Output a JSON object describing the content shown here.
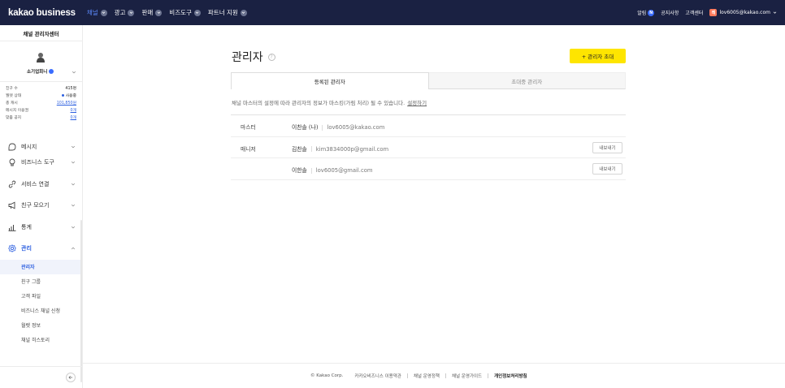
{
  "header": {
    "brand": "kakao business",
    "nav": [
      {
        "label": "채널",
        "active": true
      },
      {
        "label": "광고",
        "active": false
      },
      {
        "label": "판매",
        "active": false
      },
      {
        "label": "비즈도구",
        "active": false
      },
      {
        "label": "파트너 지원",
        "active": false
      }
    ],
    "right": {
      "notifications": "알림",
      "notifications_badge": "N",
      "notice": "공지사항",
      "support": "고객센터",
      "account_initial": "레",
      "account_email": "lov6005@kakao.com"
    }
  },
  "sidebar": {
    "title": "채널 관리자센터",
    "channel_name": "소기업회니",
    "stats": [
      {
        "label": "친구 수",
        "value": "415명"
      },
      {
        "label": "월렛 상태",
        "value": "사용중"
      },
      {
        "label": "총 캐시",
        "value": "101,850원"
      },
      {
        "label": "메시지 이용권",
        "value": "0개"
      },
      {
        "label": "맞춤 공지",
        "value": "0개"
      }
    ],
    "menu": [
      {
        "label": "메시지",
        "icon": "message-bubble-icon"
      },
      {
        "label": "비즈니스 도구",
        "icon": "bulb-icon"
      },
      {
        "label": "서비스 연결",
        "icon": "link-icon"
      },
      {
        "label": "친구 모으기",
        "icon": "megaphone-icon"
      },
      {
        "label": "통계",
        "icon": "bar-chart-icon"
      },
      {
        "label": "관리",
        "icon": "gear-icon"
      }
    ],
    "submenu": [
      {
        "label": "관리자",
        "active": true
      },
      {
        "label": "친구 그룹",
        "active": false
      },
      {
        "label": "고객 파일",
        "active": false
      },
      {
        "label": "비즈니스 채널 신청",
        "active": false
      },
      {
        "label": "월렛 정보",
        "active": false
      },
      {
        "label": "채널 히스토리",
        "active": false
      }
    ]
  },
  "main": {
    "title": "관리자",
    "help_icon": "?",
    "invite_button": "+ 관리자 초대",
    "tabs": [
      {
        "label": "등록된 관리자",
        "active": true
      },
      {
        "label": "초대중 관리자",
        "active": false
      }
    ],
    "notice": "채널 마스터의 설정에 따라 관리자의 정보가 마스킹(가림 처리) 될 수 있습니다.",
    "notice_link": "설정하기",
    "admins": [
      {
        "role": "마스터",
        "name": "이찬솔 (나)",
        "email": "lov6005@kakao.com",
        "export": ""
      },
      {
        "role": "매니저",
        "name": "김찬솔",
        "email": "kim3834000p@gmail.com",
        "export": "내보내기"
      },
      {
        "role": "",
        "name": "이한솔",
        "email": "lov6005@gmail.com",
        "export": "내보내기"
      }
    ]
  },
  "footer": {
    "links": [
      "© Kakao Corp.",
      "카카오비즈니스 이용약관",
      "채널 운영정책",
      "채널 운영가이드",
      "개인정보처리방침"
    ]
  }
}
